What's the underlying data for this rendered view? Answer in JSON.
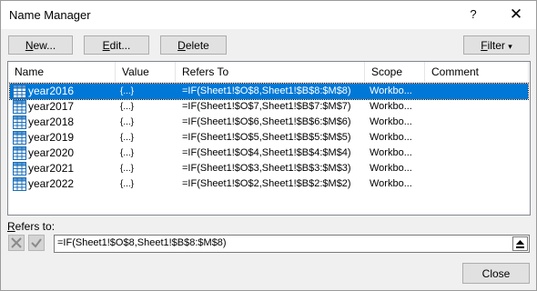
{
  "window": {
    "title": "Name Manager",
    "help_label": "?",
    "close_label": "✕"
  },
  "toolbar": {
    "new_acc": "N",
    "new_rest": "ew...",
    "edit_acc": "E",
    "edit_rest": "dit...",
    "delete_acc": "D",
    "delete_rest": "elete",
    "filter_acc": "F",
    "filter_rest": "ilter",
    "filter_arrow": "▾"
  },
  "table": {
    "columns": [
      "Name",
      "Value",
      "Refers To",
      "Scope",
      "Comment"
    ],
    "rows": [
      {
        "name": "year2016",
        "value": "{...}",
        "refers_to": "=IF(Sheet1!$O$8,Sheet1!$B$8:$M$8)",
        "scope": "Workbo...",
        "comment": "",
        "selected": true
      },
      {
        "name": "year2017",
        "value": "{...}",
        "refers_to": "=IF(Sheet1!$O$7,Sheet1!$B$7:$M$7)",
        "scope": "Workbo...",
        "comment": "",
        "selected": false
      },
      {
        "name": "year2018",
        "value": "{...}",
        "refers_to": "=IF(Sheet1!$O$6,Sheet1!$B$6:$M$6)",
        "scope": "Workbo...",
        "comment": "",
        "selected": false
      },
      {
        "name": "year2019",
        "value": "{...}",
        "refers_to": "=IF(Sheet1!$O$5,Sheet1!$B$5:$M$5)",
        "scope": "Workbo...",
        "comment": "",
        "selected": false
      },
      {
        "name": "year2020",
        "value": "{...}",
        "refers_to": "=IF(Sheet1!$O$4,Sheet1!$B$4:$M$4)",
        "scope": "Workbo...",
        "comment": "",
        "selected": false
      },
      {
        "name": "year2021",
        "value": "{...}",
        "refers_to": "=IF(Sheet1!$O$3,Sheet1!$B$3:$M$3)",
        "scope": "Workbo...",
        "comment": "",
        "selected": false
      },
      {
        "name": "year2022",
        "value": "{...}",
        "refers_to": "=IF(Sheet1!$O$2,Sheet1!$B$2:$M$2)",
        "scope": "Workbo...",
        "comment": "",
        "selected": false
      }
    ]
  },
  "refers_to": {
    "label_acc": "R",
    "label_rest": "efers to:",
    "value": "=IF(Sheet1!$O$8,Sheet1!$B$8:$M$8)"
  },
  "footer": {
    "close_label": "Close"
  },
  "icons": {
    "row_icon": "named-range-icon",
    "cancel": "cancel-x-icon",
    "commit": "checkmark-icon",
    "collapse": "collapse-dialog-icon"
  },
  "colors": {
    "selection": "#0078d7",
    "dialog_bg": "#f0f0f0",
    "button_bg": "#e1e1e1"
  }
}
